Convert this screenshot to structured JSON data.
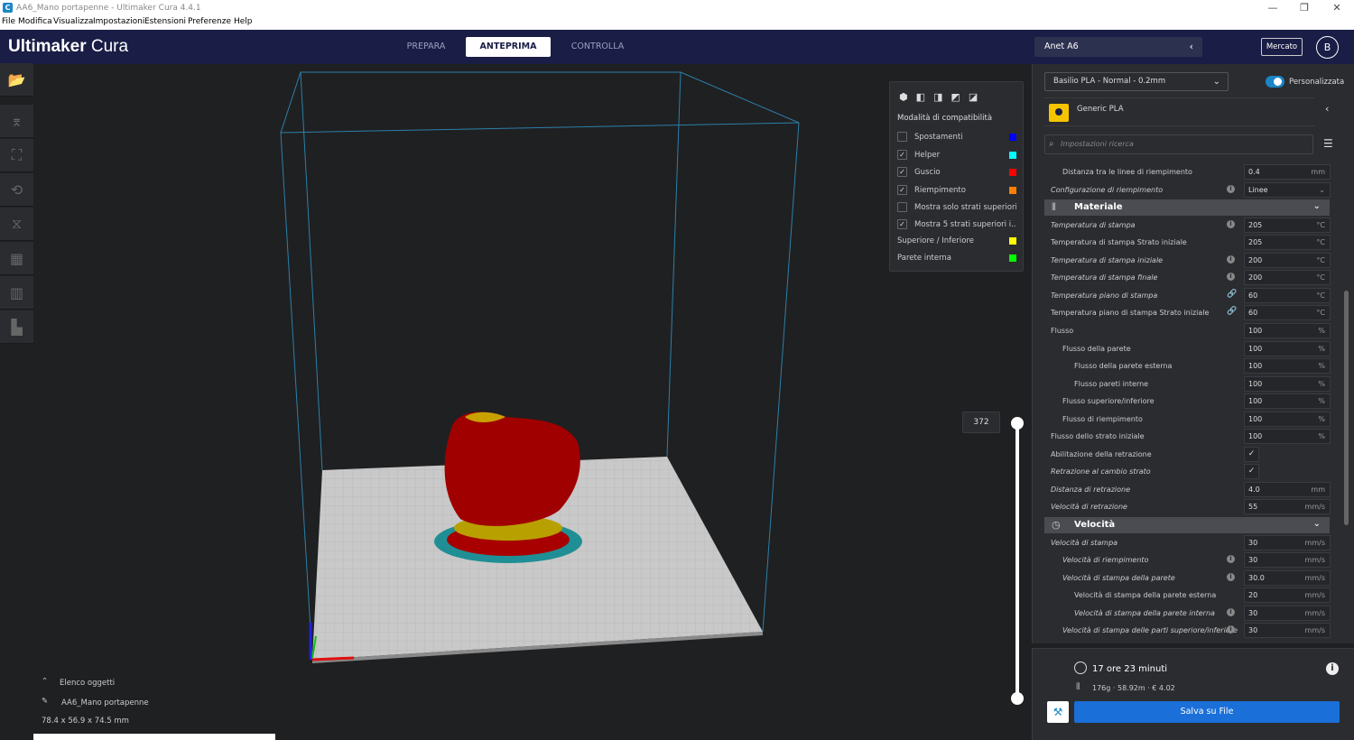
{
  "window": {
    "title": "AA6_Mano portapenne - Ultimaker Cura 4.4.1",
    "min": "—",
    "max": "❐",
    "close": "✕"
  },
  "menu": [
    "File",
    "Modifica",
    "Visualizza",
    "Impostazioni",
    "Estensioni",
    "Preferenze",
    "Help"
  ],
  "header": {
    "logo_bold": "Ultimaker",
    "logo_light": " Cura",
    "stages": [
      "PREPARA",
      "ANTEPRIMA",
      "CONTROLLA"
    ],
    "active_stage": "ANTEPRIMA",
    "printer": "Anet A6",
    "marketplace": "Mercato",
    "avatar": "B"
  },
  "legend": {
    "mode": "Modalità di compatibilità",
    "items": [
      {
        "label": "Spostamenti",
        "checked": false,
        "color": "#0000ff"
      },
      {
        "label": "Helper",
        "checked": true,
        "color": "#00ffff"
      },
      {
        "label": "Guscio",
        "checked": true,
        "color": "#ff0000"
      },
      {
        "label": "Riempimento",
        "checked": true,
        "color": "#ff8000"
      },
      {
        "label": "Mostra solo strati superiori",
        "checked": false,
        "color": ""
      },
      {
        "label": "Mostra 5 strati superiori i...",
        "checked": true,
        "color": ""
      }
    ],
    "extra": [
      {
        "label": "Superiore / Inferiore",
        "color": "#ffff00"
      },
      {
        "label": "Parete interna",
        "color": "#00ff00"
      }
    ]
  },
  "layer": {
    "value": "372"
  },
  "objects": {
    "title": "Elenco oggetti",
    "name": "AA6_Mano portapenne",
    "dims": "78.4 x 56.9 x 74.5 mm"
  },
  "panel": {
    "profile": "Basilio PLA - Normal - 0.2mm",
    "custom_label": "Personalizzata",
    "material": "Generic PLA",
    "search_placeholder": "Impostazioni ricerca"
  },
  "settings": [
    {
      "type": "row",
      "label": "Distanza tra le linee di riempimento",
      "indent": 1,
      "italic": false,
      "value": "0.4",
      "unit": "mm"
    },
    {
      "type": "row",
      "label": "Configurazione di riempimento",
      "indent": 0,
      "italic": true,
      "info": true,
      "value": "Linee",
      "unit": "⌄"
    },
    {
      "type": "head",
      "label": "Materiale",
      "icon": "⦀"
    },
    {
      "type": "row",
      "label": "Temperatura di stampa",
      "indent": 0,
      "italic": true,
      "info": true,
      "value": "205",
      "unit": "°C"
    },
    {
      "type": "row",
      "label": "Temperatura di stampa Strato iniziale",
      "indent": 0,
      "italic": false,
      "value": "205",
      "unit": "°C"
    },
    {
      "type": "row",
      "label": "Temperatura di stampa iniziale",
      "indent": 0,
      "italic": true,
      "info": true,
      "value": "200",
      "unit": "°C"
    },
    {
      "type": "row",
      "label": "Temperatura di stampa finale",
      "indent": 0,
      "italic": true,
      "info": true,
      "value": "200",
      "unit": "°C"
    },
    {
      "type": "row",
      "label": "Temperatura piano di stampa",
      "indent": 0,
      "italic": true,
      "link": true,
      "value": "60",
      "unit": "°C"
    },
    {
      "type": "row",
      "label": "Temperatura piano di stampa Strato iniziale",
      "indent": 0,
      "italic": false,
      "link": true,
      "value": "60",
      "unit": "°C"
    },
    {
      "type": "row",
      "label": "Flusso",
      "indent": 0,
      "italic": false,
      "value": "100",
      "unit": "%"
    },
    {
      "type": "row",
      "label": "Flusso della parete",
      "indent": 1,
      "italic": false,
      "value": "100",
      "unit": "%"
    },
    {
      "type": "row",
      "label": "Flusso della parete esterna",
      "indent": 2,
      "italic": false,
      "value": "100",
      "unit": "%"
    },
    {
      "type": "row",
      "label": "Flusso pareti interne",
      "indent": 2,
      "italic": false,
      "value": "100",
      "unit": "%"
    },
    {
      "type": "row",
      "label": "Flusso superiore/inferiore",
      "indent": 1,
      "italic": false,
      "value": "100",
      "unit": "%"
    },
    {
      "type": "row",
      "label": "Flusso di riempimento",
      "indent": 1,
      "italic": false,
      "value": "100",
      "unit": "%"
    },
    {
      "type": "row",
      "label": "Flusso dello strato iniziale",
      "indent": 0,
      "italic": false,
      "value": "100",
      "unit": "%"
    },
    {
      "type": "check",
      "label": "Abilitazione della retrazione",
      "indent": 0,
      "italic": false
    },
    {
      "type": "check",
      "label": "Retrazione al cambio strato",
      "indent": 0,
      "italic": true
    },
    {
      "type": "row",
      "label": "Distanza di retrazione",
      "indent": 0,
      "italic": true,
      "value": "4.0",
      "unit": "mm"
    },
    {
      "type": "row",
      "label": "Velocità di retrazione",
      "indent": 0,
      "italic": true,
      "value": "55",
      "unit": "mm/s"
    },
    {
      "type": "head",
      "label": "Velocità",
      "icon": "◷"
    },
    {
      "type": "row",
      "label": "Velocità di stampa",
      "indent": 0,
      "italic": true,
      "value": "30",
      "unit": "mm/s"
    },
    {
      "type": "row",
      "label": "Velocità di riempimento",
      "indent": 1,
      "italic": true,
      "info": true,
      "value": "30",
      "unit": "mm/s"
    },
    {
      "type": "row",
      "label": "Velocità di stampa della parete",
      "indent": 1,
      "italic": true,
      "info": true,
      "value": "30.0",
      "unit": "mm/s"
    },
    {
      "type": "row",
      "label": "Velocità di stampa della parete esterna",
      "indent": 2,
      "italic": false,
      "value": "20",
      "unit": "mm/s"
    },
    {
      "type": "row",
      "label": "Velocità di stampa della parete interna",
      "indent": 2,
      "italic": true,
      "info": true,
      "value": "30",
      "unit": "mm/s"
    },
    {
      "type": "row",
      "label": "Velocità di stampa delle parti superiore/inferiore",
      "indent": 1,
      "italic": true,
      "info": true,
      "value": "30",
      "unit": "mm/s"
    }
  ],
  "summary": {
    "time": "17 ore 23 minuti",
    "material": "176g · 58.92m · € 4.02",
    "save": "Salva su File"
  }
}
